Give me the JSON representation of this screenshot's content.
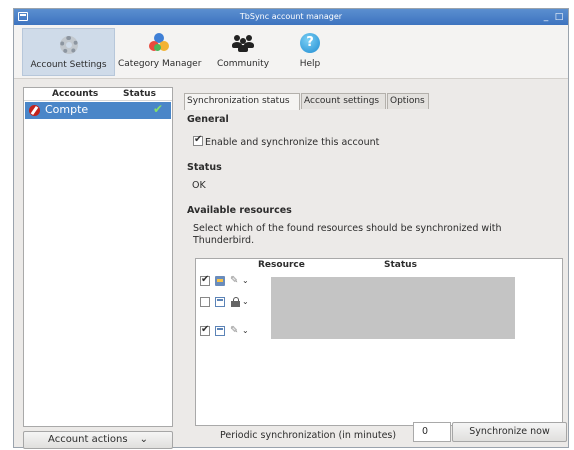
{
  "window": {
    "title": "TbSync account manager",
    "minimize_glyph": "_",
    "maximize_glyph": "□"
  },
  "toolbar": {
    "items": [
      {
        "label": "Account Settings",
        "icon": "gear-icon",
        "active": true
      },
      {
        "label": "Category Manager",
        "icon": "colored-dots-icon",
        "active": false
      },
      {
        "label": "Community",
        "icon": "people-icon",
        "active": false
      },
      {
        "label": "Help",
        "icon": "help-icon",
        "active": false
      }
    ],
    "help_glyph": "?"
  },
  "accounts": {
    "column_accounts": "Accounts",
    "column_status": "Status",
    "items": [
      {
        "name": "Compte",
        "status_icon": "check-icon",
        "status_glyph": "✔",
        "selected": true
      }
    ],
    "actions_label": "Account actions",
    "actions_chevron": "⌄"
  },
  "tabs": [
    {
      "label": "Synchronization status",
      "active": true
    },
    {
      "label": "Account settings",
      "active": false
    },
    {
      "label": "Options",
      "active": false
    }
  ],
  "panel": {
    "general_heading": "General",
    "enable_label": "Enable and synchronize this account",
    "enable_checked": true,
    "status_heading": "Status",
    "status_value": "OK",
    "resources_heading": "Available resources",
    "resources_description": "Select which of the found resources should be synchronized with Thunderbird.",
    "resource_columns": {
      "resource": "Resource",
      "status": "Status"
    },
    "resources": [
      {
        "checked": true,
        "type_icon": "address-book-icon",
        "access_icon": "pencil-icon"
      },
      {
        "checked": false,
        "type_icon": "calendar-icon",
        "access_icon": "lock-icon"
      },
      {
        "checked": true,
        "type_icon": "calendar-icon",
        "access_icon": "pencil-icon"
      }
    ],
    "periodic_label": "Periodic synchronization (in minutes)",
    "periodic_value": "0",
    "sync_button": "Synchronize now"
  },
  "colors": {
    "titlebar": "#3d73bf",
    "selection": "#4a86c8",
    "active_tool": "#cfdbe9"
  }
}
